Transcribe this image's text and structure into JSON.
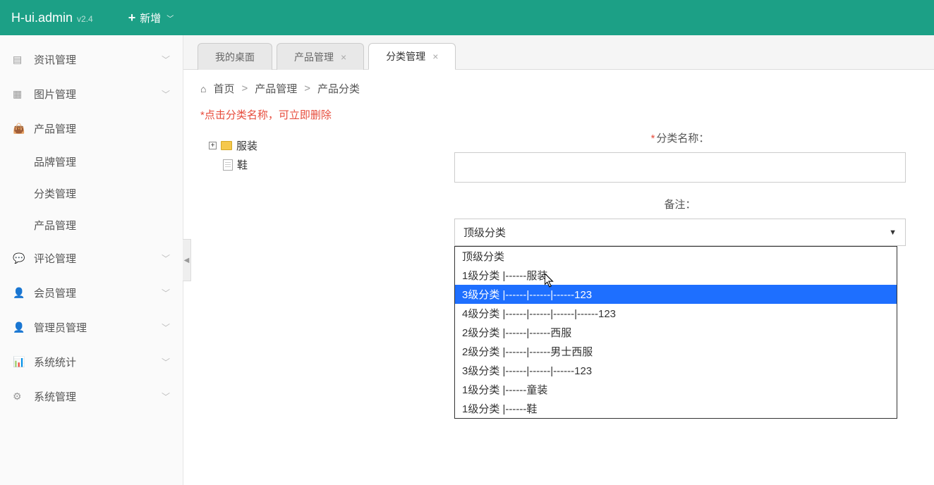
{
  "header": {
    "brand": "H-ui.admin",
    "version": "v2.4",
    "add_button": "新增"
  },
  "sidebar": {
    "items": [
      {
        "label": "资讯管理",
        "icon": "news"
      },
      {
        "label": "图片管理",
        "icon": "image"
      },
      {
        "label": "产品管理",
        "icon": "bag"
      },
      {
        "label": "评论管理",
        "icon": "comment"
      },
      {
        "label": "会员管理",
        "icon": "user"
      },
      {
        "label": "管理员管理",
        "icon": "admin"
      },
      {
        "label": "系统统计",
        "icon": "stats"
      },
      {
        "label": "系统管理",
        "icon": "gear"
      }
    ],
    "subitems": [
      {
        "label": "品牌管理"
      },
      {
        "label": "分类管理"
      },
      {
        "label": "产品管理"
      }
    ]
  },
  "tabs": [
    {
      "label": "我的桌面",
      "closable": false,
      "active": false
    },
    {
      "label": "产品管理",
      "closable": true,
      "active": false
    },
    {
      "label": "分类管理",
      "closable": true,
      "active": true
    }
  ],
  "breadcrumb": {
    "home": "首页",
    "sep": ">",
    "items": [
      "产品管理",
      "产品分类"
    ]
  },
  "hint": "*点击分类名称，可立即删除",
  "tree": {
    "root": {
      "label": "服装",
      "expanded": false
    },
    "leaf": {
      "label": "鞋"
    }
  },
  "form": {
    "name_label": "分类名称：",
    "name_value": "",
    "note_label": "备注：",
    "select_value": "顶级分类",
    "options": [
      {
        "text": "顶级分类",
        "highlighted": false
      },
      {
        "text": "1级分类 |------服装",
        "highlighted": false
      },
      {
        "text": "3级分类 |------|------|------123",
        "highlighted": true
      },
      {
        "text": "4级分类 |------|------|------|------123",
        "highlighted": false
      },
      {
        "text": "2级分类 |------|------西服",
        "highlighted": false
      },
      {
        "text": "2级分类 |------|------男士西服",
        "highlighted": false
      },
      {
        "text": "3级分类 |------|------|------123",
        "highlighted": false
      },
      {
        "text": "1级分类 |------童装",
        "highlighted": false
      },
      {
        "text": "1级分类 |------鞋",
        "highlighted": false
      }
    ]
  }
}
